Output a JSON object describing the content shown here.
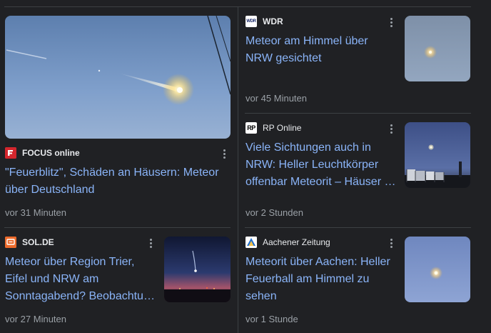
{
  "articles": [
    {
      "source": "FOCUS online",
      "title": "\"Feuerblitz\", Schäden an Häusern: Meteor über Deutschland",
      "time": "vor 31 Minuten",
      "logo_icon": "focus-logo-icon",
      "image": "meteor-streak-thumbnail"
    },
    {
      "source": "WDR",
      "logo_text": "WDR",
      "title": "Meteor am Himmel über NRW gesichtet",
      "time": "vor 45 Minuten",
      "logo_icon": "wdr-logo-icon",
      "image": "meteor-glow-thumbnail"
    },
    {
      "source": "RP Online",
      "logo_text": "RP",
      "title": "Viele Sichtungen auch in NRW: Heller Leuchtkörper offenbar Meteorit – Häuser …",
      "time": "vor 2 Stunden",
      "logo_icon": "rp-logo-icon",
      "image": "night-sky-fence-thumbnail"
    },
    {
      "source": "SOL.DE",
      "title": "Meteor über Region Trier, Eifel und NRW am Sonntagabend? Beobachtu…",
      "time": "vor 27 Minuten",
      "logo_icon": "sol-logo-icon",
      "image": "meteor-dusk-thumbnail"
    },
    {
      "source": "Aachener Zeitung",
      "title": "Meteorit über Aachen: Heller Feuerball am Himmel zu sehen",
      "time": "vor 1 Stunde",
      "logo_icon": "aachener-logo-icon",
      "image": "meteor-fireball-thumbnail"
    }
  ],
  "colors": {
    "background": "#202124",
    "title_link": "#8ab4f8",
    "meta_text": "#9aa0a6",
    "source_text": "#e8eaed",
    "divider": "#3c4043"
  }
}
